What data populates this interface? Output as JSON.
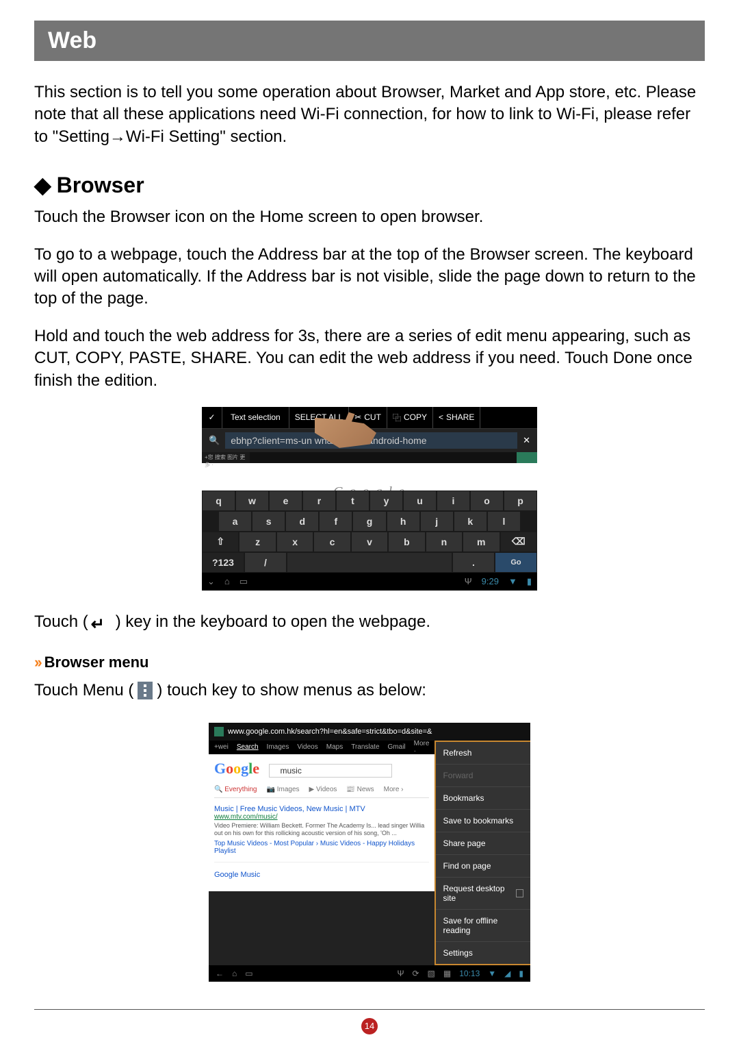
{
  "title": "Web",
  "intro": "This section is to tell you some operation about Browser, Market and App store, etc. Please note that all these applications need Wi-Fi connection, for how to link to Wi-Fi, please refer to \"Setting→Wi-Fi Setting\" section.",
  "section_heading": "Browser",
  "p1": "Touch the Browser icon on the Home screen to open browser.",
  "p2": "To go to a webpage, touch the Address bar at the top of the Browser screen. The keyboard will open automatically. If the Address bar is not visible, slide the page down to return to the top of the page.",
  "p3": "Hold and touch the web address for 3s, there are a series of edit menu appearing, such as CUT, COPY, PASTE, SHARE. You can edit the web address if you need. Touch Done once finish the edition.",
  "touch_key_pre": "Touch (",
  "touch_key_post": ") key in the keyboard to open the webpage.",
  "sub_heading": "Browser menu",
  "menu_line_pre": "Touch Menu (",
  "menu_line_post": ") touch key to show menus as below:",
  "page_number": "14",
  "shot1": {
    "toolbar": {
      "label": "Text selection",
      "select_all": "SELECT ALL",
      "cut": "CUT",
      "copy": "COPY",
      "share": "SHARE"
    },
    "address": "ebhp?client=ms-un        wn&source=android-home",
    "google_partial": "Google",
    "keys_r1": [
      "q",
      "w",
      "e",
      "r",
      "t",
      "y",
      "u",
      "i",
      "o",
      "p"
    ],
    "keys_r2": [
      "a",
      "s",
      "d",
      "f",
      "g",
      "h",
      "j",
      "k",
      "l"
    ],
    "keys_r3": [
      "⇧",
      "z",
      "x",
      "c",
      "v",
      "b",
      "n",
      "m",
      "⌫"
    ],
    "keys_r4_123": "?123",
    "keys_r4_slash": "/",
    "keys_r4_dot": ".",
    "keys_r4_go": "Go",
    "nav_time": "9:29"
  },
  "shot2": {
    "address": "www.google.com.hk/search?hl=en&safe=strict&tbo=d&site=&",
    "tabs": [
      "+wei",
      "Search",
      "Images",
      "Videos",
      "Maps",
      "Translate",
      "Gmail",
      "More ·"
    ],
    "search_query": "music",
    "filters": [
      "Everything",
      "Images",
      "Videos",
      "News",
      "More  ›"
    ],
    "result1_title": "Music | Free Music Videos, New Music | MTV",
    "result1_url": "www.mtv.com/music/",
    "result1_desc": "Video Premiere: William Beckett. Former The Academy Is... lead singer Willia out on his own for this rollicking acoustic version of his song, 'Oh ...",
    "result1_sub": "Top Music Videos - Most Popular › Music Videos - Happy Holidays Playlist",
    "result2_title": "Google Music",
    "menu": {
      "refresh": "Refresh",
      "forward": "Forward",
      "bookmarks": "Bookmarks",
      "save_bookmarks": "Save to bookmarks",
      "share_page": "Share page",
      "find_page": "Find on page",
      "request_desktop": "Request desktop site",
      "offline": "Save for offline reading",
      "settings": "Settings"
    },
    "nav_time": "10:13"
  }
}
